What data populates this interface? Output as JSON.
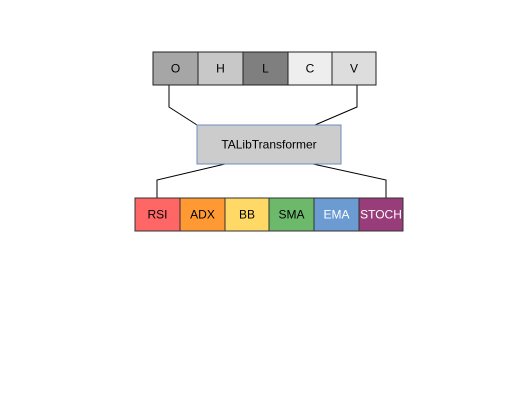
{
  "diagram": {
    "inputs": [
      {
        "label": "O",
        "fill": "#a6a6a6",
        "text_color": "#000000"
      },
      {
        "label": "H",
        "fill": "#c8c8c8",
        "text_color": "#000000"
      },
      {
        "label": "L",
        "fill": "#7f7f7f",
        "text_color": "#000000"
      },
      {
        "label": "C",
        "fill": "#eeeeee",
        "text_color": "#000000"
      },
      {
        "label": "V",
        "fill": "#dddddd",
        "text_color": "#000000"
      }
    ],
    "transformer": {
      "label": "TALibTransformer",
      "fill": "#cccccc",
      "border": "#6c8ebf"
    },
    "outputs": [
      {
        "label": "RSI",
        "fill": "#ff6666",
        "text_color": "#000000"
      },
      {
        "label": "ADX",
        "fill": "#ff9933",
        "text_color": "#000000"
      },
      {
        "label": "BB",
        "fill": "#ffd966",
        "text_color": "#000000"
      },
      {
        "label": "SMA",
        "fill": "#6cb96c",
        "text_color": "#000000"
      },
      {
        "label": "EMA",
        "fill": "#6c9bd2",
        "text_color": "#ffffff"
      },
      {
        "label": "STOCH",
        "fill": "#993d7a",
        "text_color": "#ffffff"
      }
    ]
  }
}
